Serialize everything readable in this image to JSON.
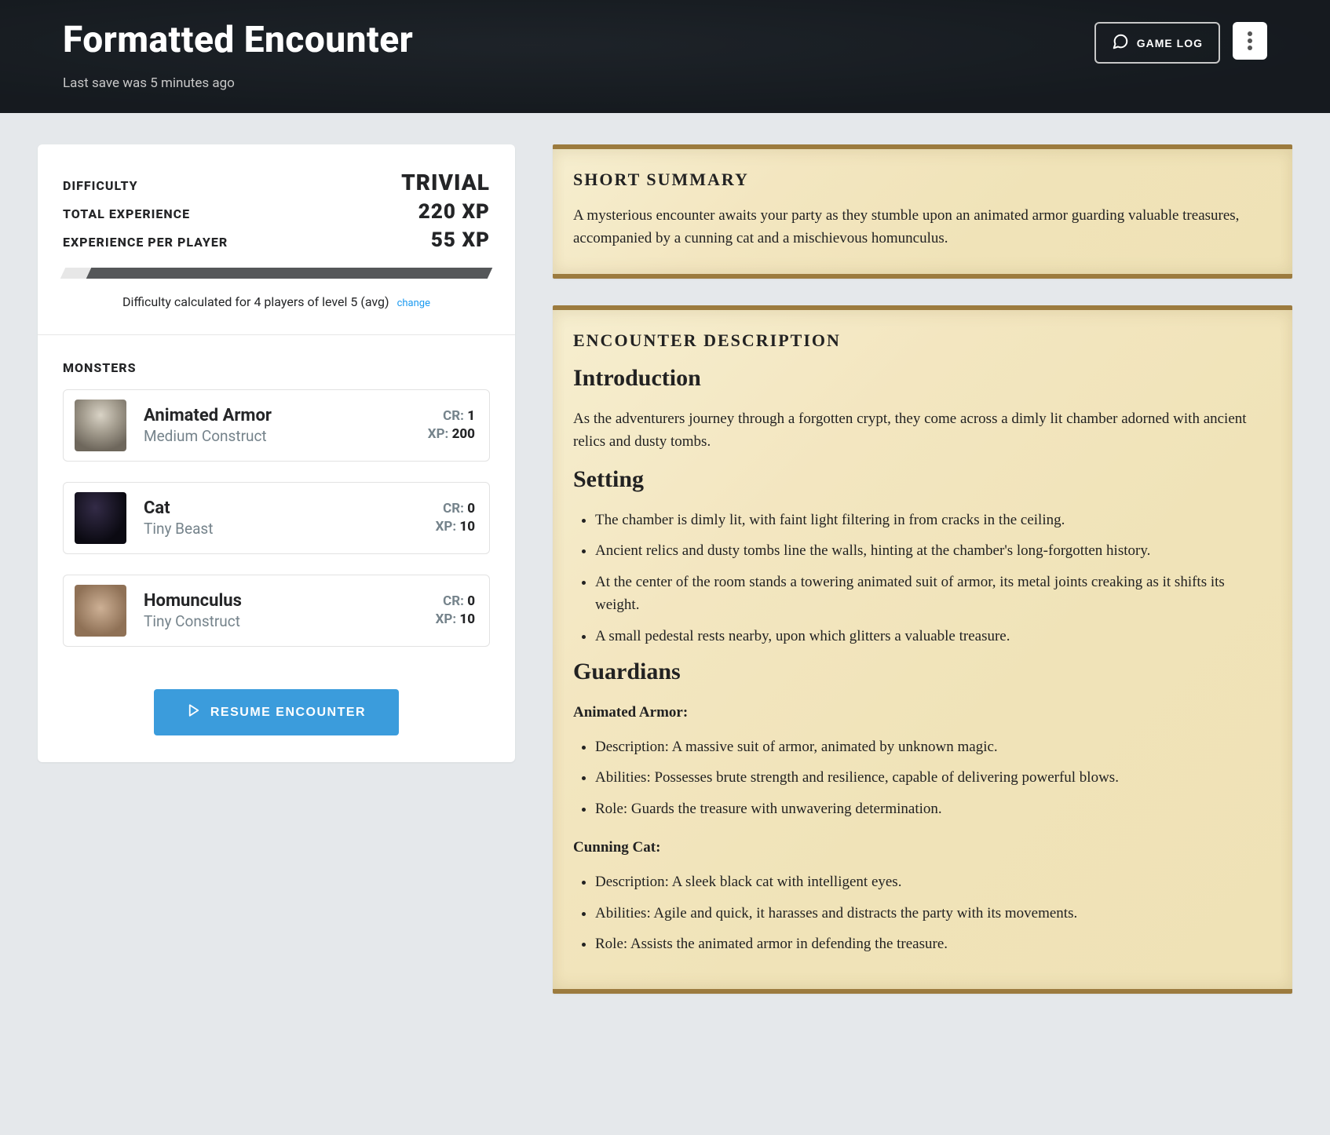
{
  "header": {
    "title": "Formatted Encounter",
    "last_save": "Last save was 5 minutes ago",
    "game_log_label": "GAME LOG"
  },
  "stats": {
    "difficulty_label": "DIFFICULTY",
    "difficulty_value": "TRIVIAL",
    "total_xp_label": "TOTAL EXPERIENCE",
    "total_xp_value": "220 XP",
    "xp_per_player_label": "EXPERIENCE PER PLAYER",
    "xp_per_player_value": "55 XP",
    "caption": "Difficulty calculated for 4 players of level 5 (avg)",
    "change_label": "change"
  },
  "monsters_label": "MONSTERS",
  "monsters": [
    {
      "name": "Animated Armor",
      "type": "Medium Construct",
      "cr": "1",
      "xp": "200"
    },
    {
      "name": "Cat",
      "type": "Tiny Beast",
      "cr": "0",
      "xp": "10"
    },
    {
      "name": "Homunculus",
      "type": "Tiny Construct",
      "cr": "0",
      "xp": "10"
    }
  ],
  "cr_label": "CR:",
  "xp_label": "XP:",
  "resume_label": "RESUME ENCOUNTER",
  "summary": {
    "heading": "SHORT SUMMARY",
    "text": "A mysterious encounter awaits your party as they stumble upon an animated armor guarding valuable treasures, accompanied by a cunning cat and a mischievous homunculus."
  },
  "description": {
    "heading": "ENCOUNTER DESCRIPTION",
    "intro_h": "Introduction",
    "intro_p": "As the adventurers journey through a forgotten crypt, they come across a dimly lit chamber adorned with ancient relics and dusty tombs.",
    "setting_h": "Setting",
    "setting_items": [
      "The chamber is dimly lit, with faint light filtering in from cracks in the ceiling.",
      "Ancient relics and dusty tombs line the walls, hinting at the chamber's long-forgotten history.",
      "At the center of the room stands a towering animated suit of armor, its metal joints creaking as it shifts its weight.",
      "A small pedestal rests nearby, upon which glitters a valuable treasure."
    ],
    "guardians_h": "Guardians",
    "guardians": [
      {
        "name": "Animated Armor:",
        "items": [
          "Description: A massive suit of armor, animated by unknown magic.",
          "Abilities: Possesses brute strength and resilience, capable of delivering powerful blows.",
          "Role: Guards the treasure with unwavering determination."
        ]
      },
      {
        "name": "Cunning Cat:",
        "items": [
          "Description: A sleek black cat with intelligent eyes.",
          "Abilities: Agile and quick, it harasses and distracts the party with its movements.",
          "Role: Assists the animated armor in defending the treasure."
        ]
      }
    ]
  }
}
